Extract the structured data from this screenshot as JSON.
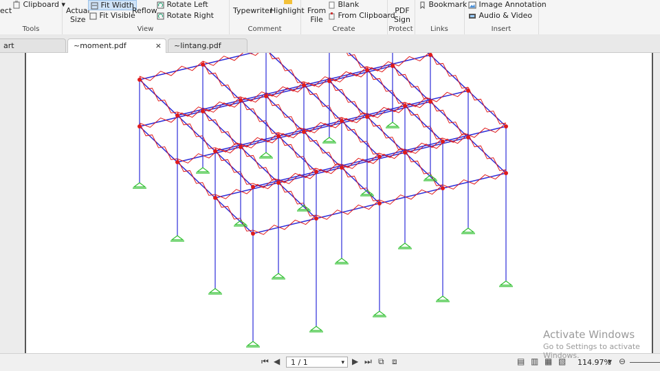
{
  "ribbon": {
    "tools": {
      "select_label": "ect",
      "clipboard_label": "Clipboard",
      "group_label": "Tools"
    },
    "view": {
      "actual_size_line1": "Actual",
      "actual_size_line2": "Size",
      "fit_width": "Fit Width",
      "fit_visible": "Fit Visible",
      "reflow": "Reflow",
      "rotate_left": "Rotate Left",
      "rotate_right": "Rotate Right",
      "group_label": "View"
    },
    "comment": {
      "typewriter": "Typewriter",
      "highlight": "Highlight",
      "group_label": "Comment"
    },
    "create": {
      "from_file_line1": "From",
      "from_file_line2": "File",
      "blank": "Blank",
      "from_clipboard": "From Clipboard",
      "group_label": "Create"
    },
    "protect": {
      "pdf_sign_line1": "PDF",
      "pdf_sign_line2": "Sign",
      "group_label": "Protect"
    },
    "links": {
      "bookmark": "Bookmark",
      "group_label": "Links"
    },
    "insert": {
      "image_annotation": "Image Annotation",
      "audio_video": "Audio & Video",
      "group_label": "Insert"
    }
  },
  "tabs": [
    {
      "label": "art"
    },
    {
      "label": "~moment.pdf",
      "close": "×"
    },
    {
      "label": "~lintang.pdf"
    }
  ],
  "status": {
    "page_display": "1 / 1",
    "zoom": "114.97%"
  },
  "watermark": {
    "line1": "Activate Windows",
    "line2": "Go to Settings to activate Windows."
  },
  "colors": {
    "frame_member": "#2b2bd8",
    "moment_diagram": "#e01b1b",
    "support": "#2fbf2f"
  }
}
